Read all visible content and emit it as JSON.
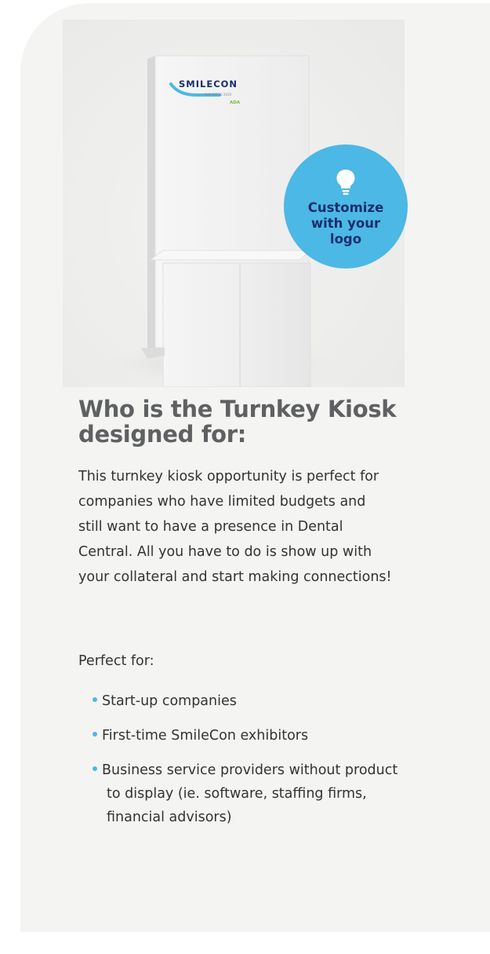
{
  "hero": {
    "kiosk_brand": "SMILECON",
    "kiosk_sub": "SAN DIEGO 2019",
    "kiosk_tag": "ADA",
    "badge_text": "Customize with your logo",
    "colors": {
      "badge": "#4cb8e5",
      "badge_text": "#1a2e6e"
    }
  },
  "content": {
    "heading": "Who is the Turnkey Kiosk designed for:",
    "intro": "This turnkey kiosk opportunity is perfect for companies who have limited budgets and still want to have a presence in Dental Central. All you have to do is show up with your collateral and start making connections!",
    "perfect_for_label": "Perfect for:",
    "items": [
      "Start-up companies",
      "First-time SmileCon exhibitors",
      "Business service providers without product to display (ie. software, staffing firms, financial advisors)"
    ]
  }
}
